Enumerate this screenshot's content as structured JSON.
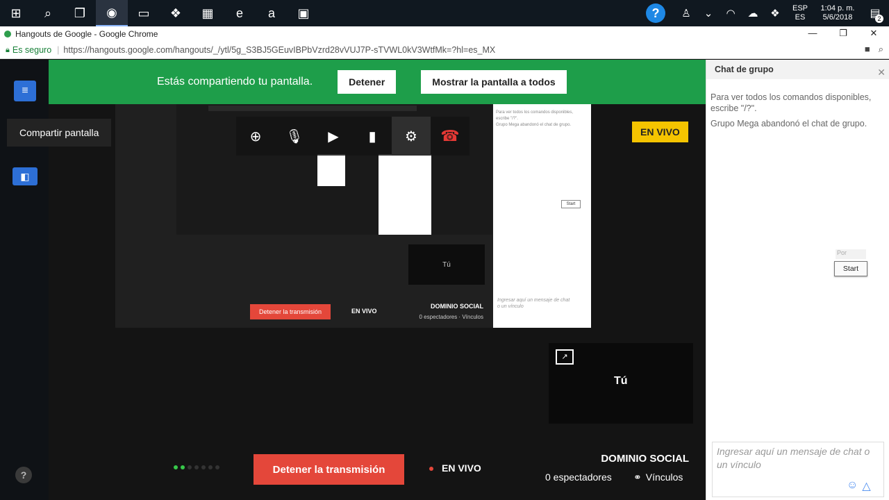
{
  "taskbar": {
    "icons": [
      "windows-start",
      "search",
      "task-view",
      "chrome",
      "file-explorer",
      "dropbox",
      "store",
      "edge",
      "amazon",
      "photos"
    ],
    "help": "?",
    "lang_top": "ESP",
    "lang_bottom": "ES",
    "time": "1:04 p. m.",
    "date": "5/6/2018",
    "notifications": "2"
  },
  "browser": {
    "title": "Hangouts de Google - Google Chrome",
    "secure_label": "Es seguro",
    "url": "https://hangouts.google.com/hangouts/_/ytl/5g_S3BJ5GEuvIBPbVzrd28vVUJ7P-sTVWL0kV3WtfMk=?hl=es_MX"
  },
  "share": {
    "message": "Estás compartiendo tu pantalla.",
    "stop": "Detener",
    "show_all": "Mostrar la pantalla a todos",
    "tooltip": "Compartir pantalla"
  },
  "live_badge": "EN VIVO",
  "preview": {
    "tu": "Tú",
    "stop": "Detener la transmisión",
    "live": "EN VIVO",
    "domain": "DOMINIO SOCIAL",
    "viewers": "0 espectadores",
    "links": "Vínculos",
    "chat_help": "Para ver todos los comandos disponibles, escribe \"/?\".",
    "chat_left": "Grupo Mega abandonó el chat de grupo.",
    "chat_start": "Start",
    "chat_input": "Ingresar aquí un mensaje de chat o un vínculo"
  },
  "self_view": {
    "label": "Tú"
  },
  "bottom": {
    "stop_label": "Detener la transmisión",
    "live_label": "EN VIVO",
    "domain": "DOMINIO SOCIAL",
    "viewers": "0 espectadores",
    "links": "Vínculos"
  },
  "chat": {
    "title": "Chat de grupo",
    "help_text": "Para ver todos los comandos disponibles, escribe \"/?\".",
    "left_message": "Grupo Mega abandonó el chat de grupo.",
    "start_label": "Start",
    "start_pre": "Por",
    "input_placeholder": "Ingresar aquí un mensaje de chat o un vínculo"
  },
  "colors": {
    "share_bar": "#1e9e4a",
    "live_badge": "#f5c400",
    "stop_button": "#e4473a",
    "accent_blue": "#2d6fd6"
  }
}
